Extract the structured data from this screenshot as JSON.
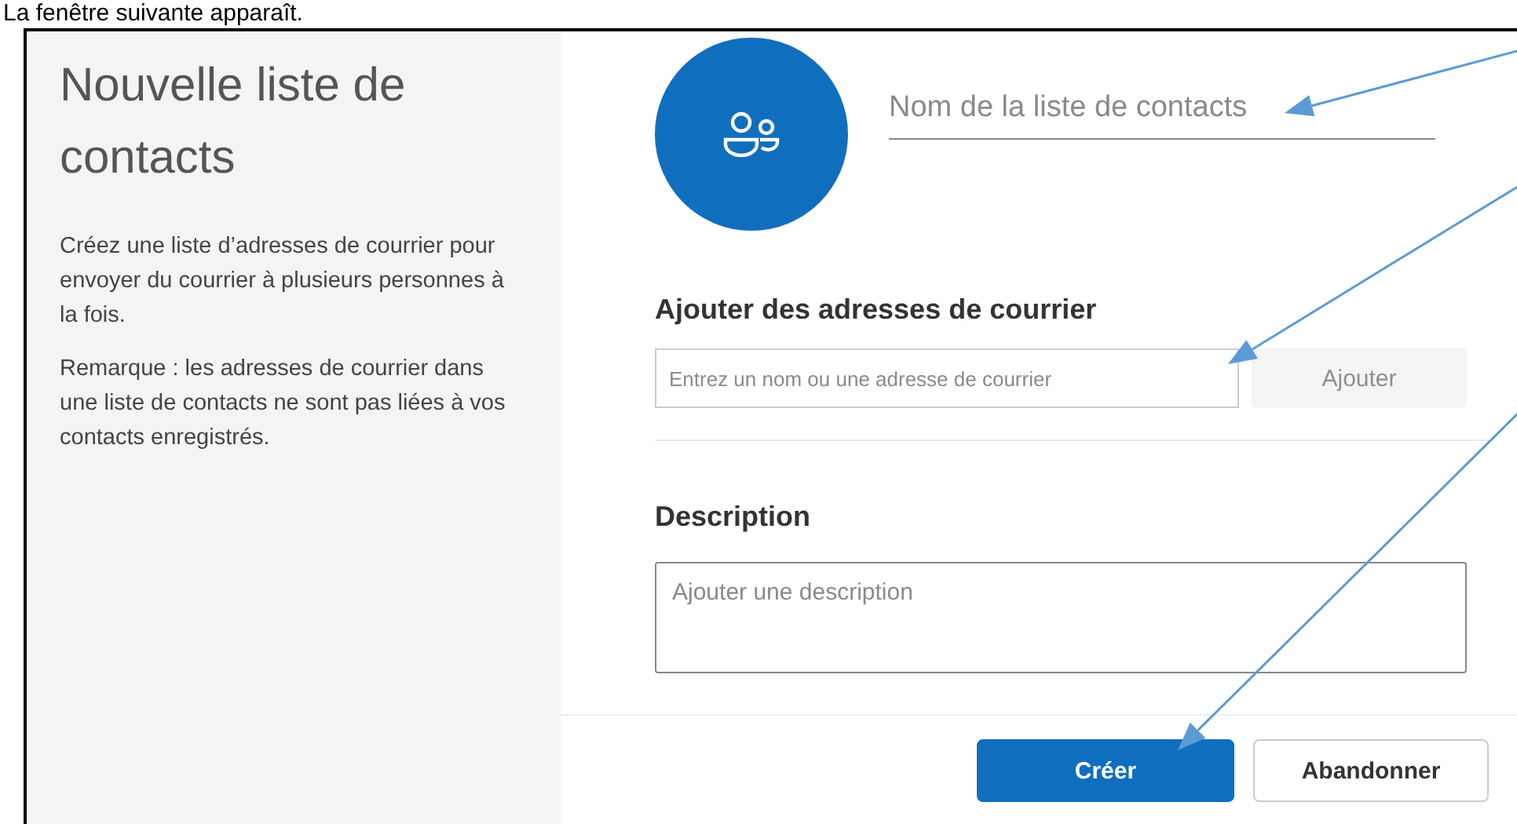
{
  "caption": "La fenêtre suivante apparaît.",
  "sidebar": {
    "title": "Nouvelle liste de contacts",
    "paragraphs": [
      "Créez une liste d’adresses de courrier pour envoyer du courrier à plusieurs personnes à la fois.",
      "Remarque : les adresses de courrier dans une liste de contacts ne sont pas liées à vos contacts enregistrés."
    ]
  },
  "name_field": {
    "placeholder": "Nom de la liste de contacts"
  },
  "add_section": {
    "heading": "Ajouter des adresses de courrier",
    "placeholder": "Entrez un nom ou une adresse de courrier",
    "button": {
      "label": "Ajouter",
      "disabled": true
    }
  },
  "description_section": {
    "heading": "Description",
    "placeholder": "Ajouter une description"
  },
  "buttons": [
    {
      "label": "Créer",
      "kind": "primary"
    },
    {
      "label": "Abandonner",
      "kind": "default"
    }
  ]
}
